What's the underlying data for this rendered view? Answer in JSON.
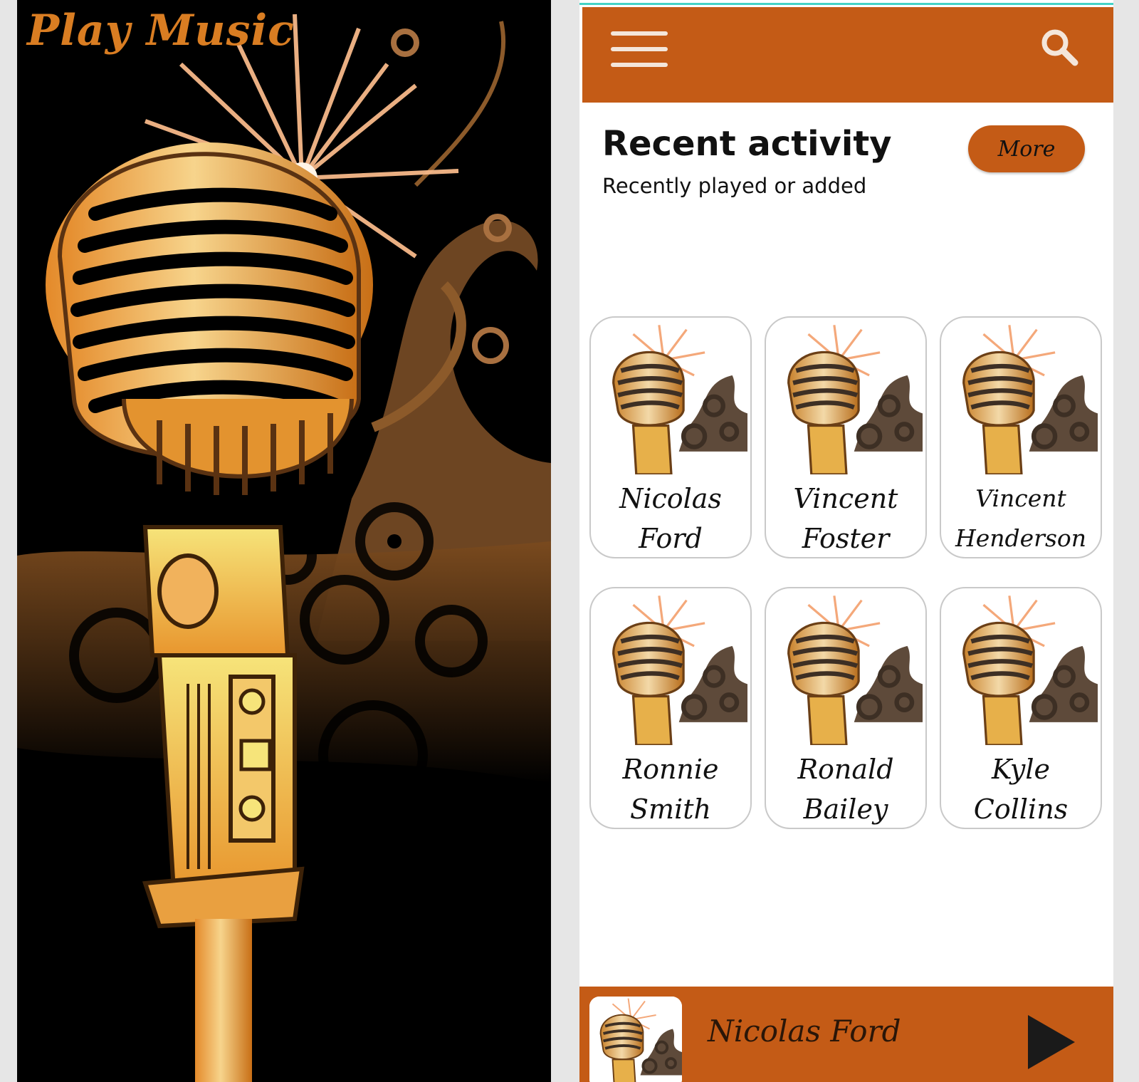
{
  "splash": {
    "logo_text": "Play Music",
    "artwork": "retro-microphone-illustration"
  },
  "header": {
    "menu_icon": "hamburger-menu-icon",
    "search_icon": "search-icon"
  },
  "recent": {
    "title": "Recent activity",
    "subtitle": "Recently played or added",
    "more_label": "More"
  },
  "artists": [
    {
      "line1": "Nicolas",
      "line2": "Ford",
      "thumbnail": "microphone-thumbnail"
    },
    {
      "line1": "Vincent",
      "line2": "Foster",
      "thumbnail": "microphone-thumbnail"
    },
    {
      "line1": "Vincent",
      "line2": "Henderson",
      "thumbnail": "microphone-thumbnail"
    },
    {
      "line1": "Ronnie",
      "line2": "Smith",
      "thumbnail": "microphone-thumbnail"
    },
    {
      "line1": "Ronald",
      "line2": "Bailey",
      "thumbnail": "microphone-thumbnail"
    },
    {
      "line1": "Kyle",
      "line2": "Collins",
      "thumbnail": "microphone-thumbnail"
    }
  ],
  "player": {
    "now_playing": "Nicolas Ford",
    "play_icon": "play-icon"
  },
  "colors": {
    "accent": "#c45b16",
    "logo": "#d97d22",
    "splash_background": "#000000",
    "highlight_line": "#45d3c6"
  }
}
